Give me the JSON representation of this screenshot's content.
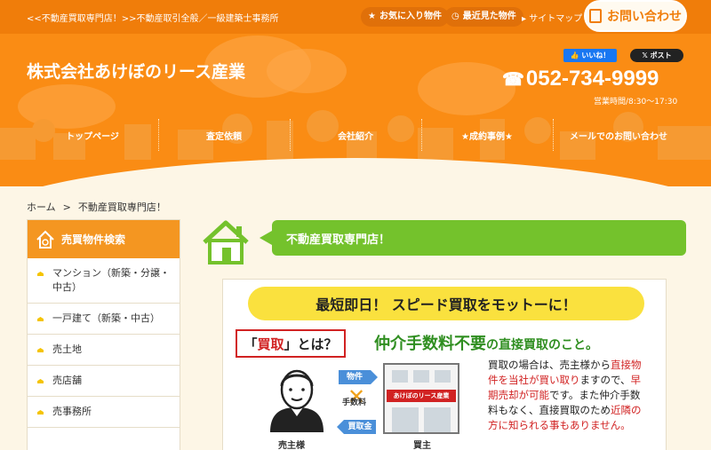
{
  "header": {
    "tagline": "<<不動産買取専門店！>>不動産取引全般／一級建築士事務所",
    "favorites": "お気に入り物件",
    "recent": "最近見た物件",
    "sitemap": "サイトマップ",
    "contact": "お問い合わせ",
    "company": "株式会社あけぼのリース産業",
    "fb_like": "いいね！",
    "x_post": "ポスト",
    "phone": "052-734-9999",
    "hours": "営業時間/8:30〜17:30"
  },
  "nav": [
    {
      "label": "トップページ"
    },
    {
      "label": "査定依頼"
    },
    {
      "label": "会社紹介"
    },
    {
      "label": "★成約事例★"
    },
    {
      "label": "メールでのお問い合わせ"
    }
  ],
  "breadcrumb": {
    "home": "ホーム",
    "sep": ">",
    "current": "不動産買取専門店！"
  },
  "sidebar": {
    "title": "売買物件検索",
    "items": [
      {
        "label": "マンション（新築・分譲・中古）"
      },
      {
        "label": "一戸建て（新築・中古）"
      },
      {
        "label": "売土地"
      },
      {
        "label": "売店舗"
      },
      {
        "label": "売事務所"
      }
    ]
  },
  "main": {
    "title": "不動産買取専門店！",
    "banner": {
      "headline": "最短即日！ スピード買取をモットーに！",
      "kaitori_q_open": "「",
      "kaitori_q_word": "買取",
      "kaitori_q_close": "」とは？",
      "big_line_main": "仲介手数料不要",
      "big_line_rest": "の直接買取のこと。",
      "arrow_property": "物件",
      "fee": "手数料",
      "arrow_money": "買取金",
      "store_sign": "あけぼのリース産業",
      "seller": "売主様",
      "buyer": "買主",
      "desc_1": "買取の場合は、売主様から",
      "desc_2": "直接物件を当社が買い取り",
      "desc_3": "ますので、",
      "desc_4": "早期売却が可能",
      "desc_5": "です。また仲介手数料もなく、直接買取のため",
      "desc_6": "近隣の方に知られる事もありません。"
    }
  }
}
